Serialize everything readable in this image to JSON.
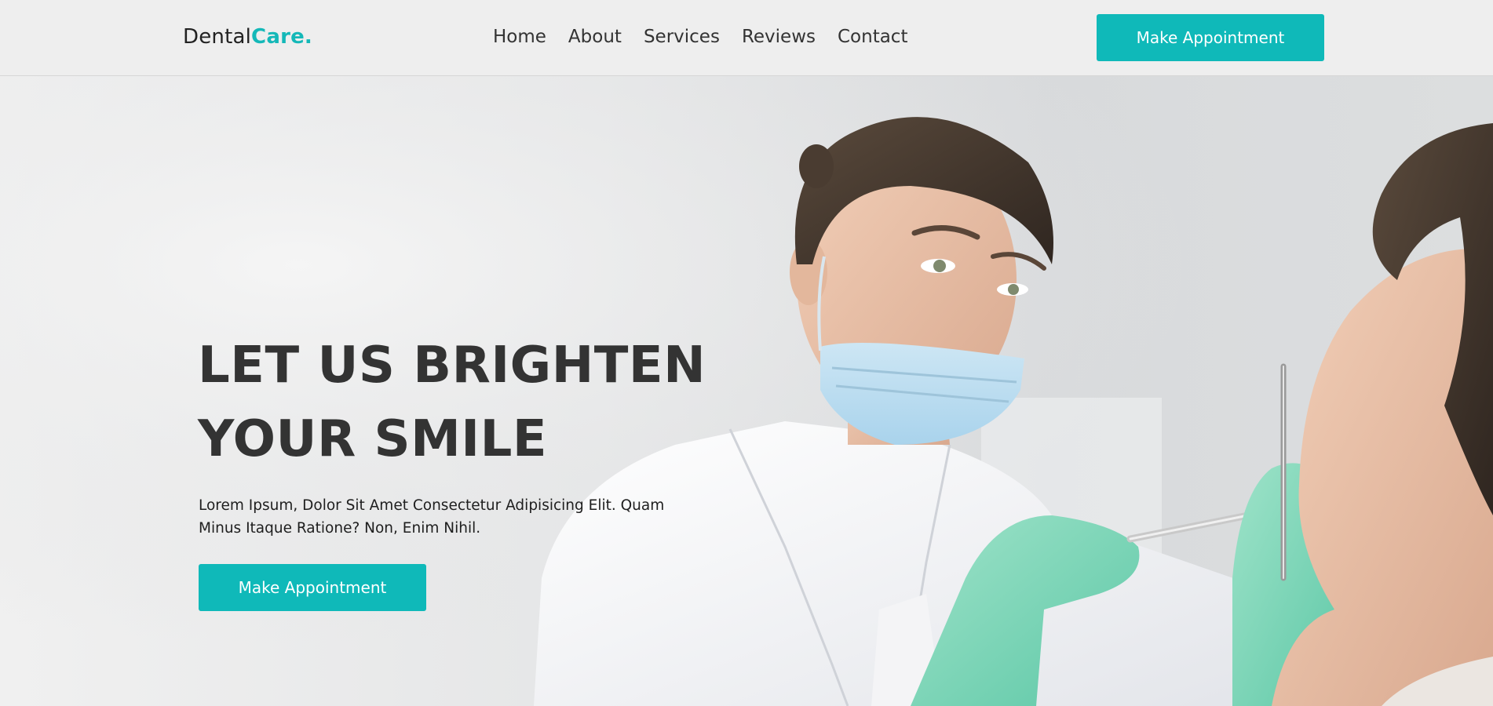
{
  "logo": {
    "main": "Dental",
    "accent": "Care."
  },
  "nav": {
    "items": [
      {
        "label": "Home"
      },
      {
        "label": "About"
      },
      {
        "label": "Services"
      },
      {
        "label": "Reviews"
      },
      {
        "label": "Contact"
      }
    ]
  },
  "header": {
    "cta_label": "Make Appointment"
  },
  "hero": {
    "title_line1": "LET US BRIGHTEN",
    "title_line2": "YOUR SMILE",
    "description": "Lorem Ipsum, Dolor Sit Amet Consectetur Adipisicing Elit. Quam Minus Itaque Ratione? Non, Enim Nihil.",
    "cta_label": "Make Appointment",
    "image_subject": "dentist-with-patient"
  },
  "colors": {
    "accent": "#0fb9b9",
    "text_dark": "#333333",
    "header_bg": "#eeeeee"
  }
}
